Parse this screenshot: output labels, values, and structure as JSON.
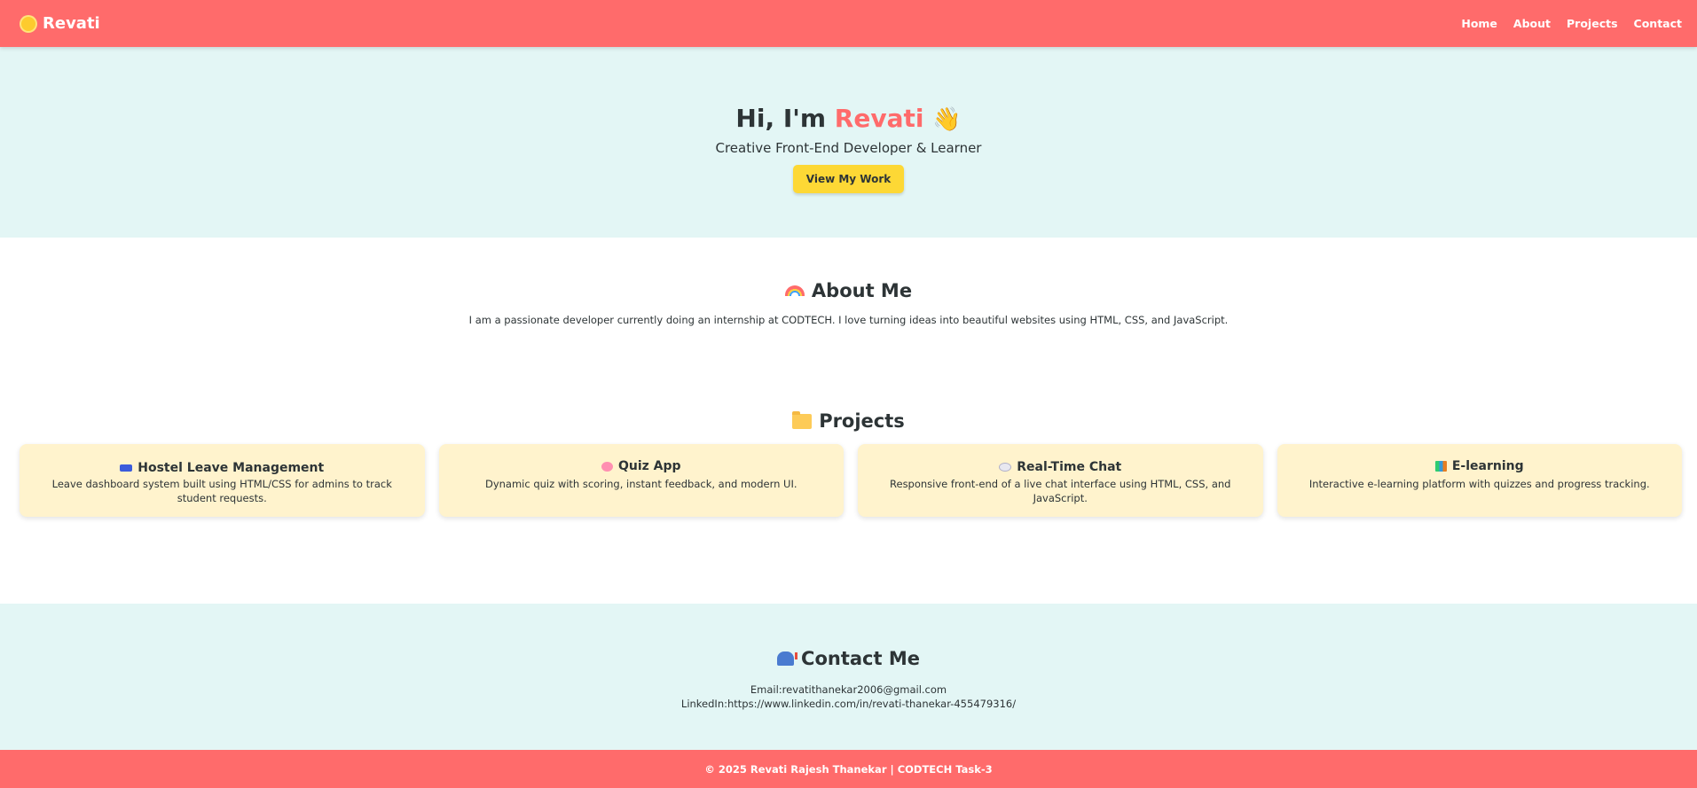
{
  "nav": {
    "brand": "Revati",
    "links": [
      "Home",
      "About",
      "Projects",
      "Contact"
    ]
  },
  "hero": {
    "greeting": "Hi, I'm ",
    "name": "Revati",
    "wave": "👋",
    "subtitle": "Creative Front-End Developer & Learner",
    "button": "View My Work"
  },
  "about": {
    "title": "About Me",
    "text": "I am a passionate developer currently doing an internship at CODTECH. I love turning ideas into beautiful websites using HTML, CSS, and JavaScript."
  },
  "projects": {
    "title": "Projects",
    "items": [
      {
        "icon": "bed-icon",
        "title": "Hostel Leave Management",
        "desc": "Leave dashboard system built using HTML/CSS for admins to track student requests."
      },
      {
        "icon": "brain-icon",
        "title": "Quiz App",
        "desc": "Dynamic quiz with scoring, instant feedback, and modern UI."
      },
      {
        "icon": "speech-bubble-icon",
        "title": "Real-Time Chat",
        "desc": "Responsive front-end of a live chat interface using HTML, CSS, and JavaScript."
      },
      {
        "icon": "books-icon",
        "title": "E-learning",
        "desc": "Interactive e-learning platform with quizzes and progress tracking."
      }
    ]
  },
  "contact": {
    "title": "Contact Me",
    "email": "Email:revatithanekar2006@gmail.com",
    "linkedin": "LinkedIn:https://www.linkedin.com/in/revati-thanekar-455479316/"
  },
  "footer": {
    "text": "© 2025 Revati Rajesh Thanekar | CODTECH Task-3"
  },
  "colors": {
    "primary": "#ff6b6b",
    "hero_bg": "#e3f6f5",
    "button": "#fdd835",
    "card_bg": "#fff3cd"
  }
}
